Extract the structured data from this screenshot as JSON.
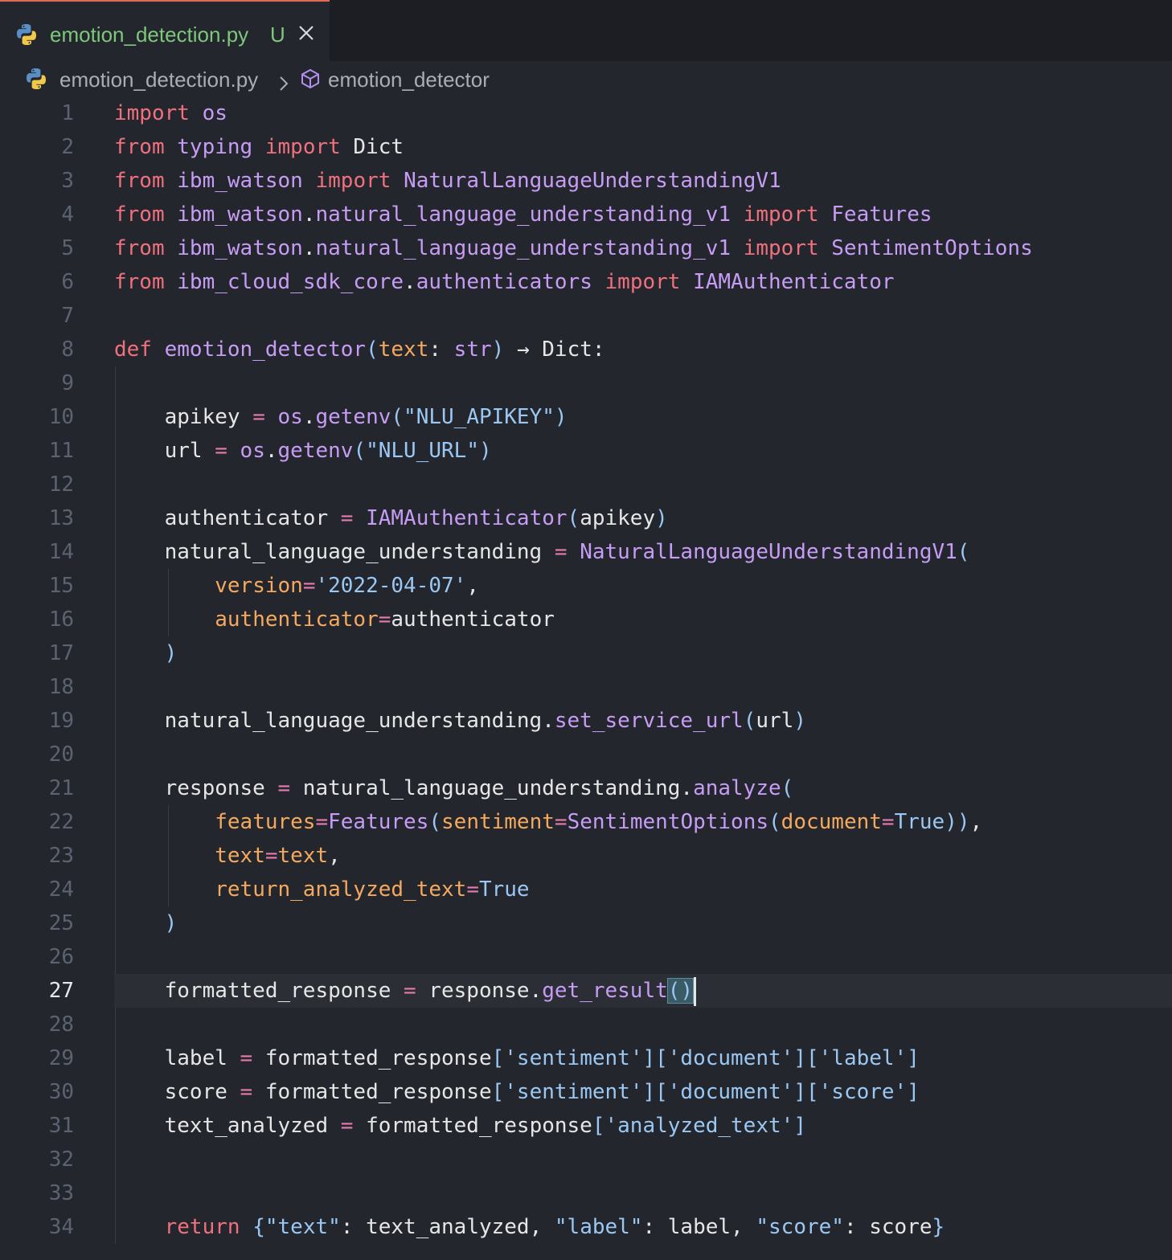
{
  "tab": {
    "filename": "emotion_detection.py",
    "status": "U",
    "icon": "python-icon",
    "close_icon": "close-icon"
  },
  "breadcrumb": {
    "file": "emotion_detection.py",
    "separator_icon": "chevron-right-icon",
    "symbol_icon": "cube-icon",
    "symbol": "emotion_detector"
  },
  "editor": {
    "current_line": 27,
    "lines": [
      {
        "n": "1",
        "tokens": [
          [
            "kw",
            "import"
          ],
          [
            "pl",
            " "
          ],
          [
            "mod",
            "os"
          ]
        ]
      },
      {
        "n": "2",
        "tokens": [
          [
            "kw",
            "from"
          ],
          [
            "pl",
            " "
          ],
          [
            "mod",
            "typing"
          ],
          [
            "pl",
            " "
          ],
          [
            "kw",
            "import"
          ],
          [
            "pl",
            " Dict"
          ]
        ]
      },
      {
        "n": "3",
        "tokens": [
          [
            "kw",
            "from"
          ],
          [
            "pl",
            " "
          ],
          [
            "mod",
            "ibm_watson"
          ],
          [
            "pl",
            " "
          ],
          [
            "kw",
            "import"
          ],
          [
            "pl",
            " "
          ],
          [
            "cls",
            "NaturalLanguageUnderstandingV1"
          ]
        ]
      },
      {
        "n": "4",
        "tokens": [
          [
            "kw",
            "from"
          ],
          [
            "pl",
            " "
          ],
          [
            "mod",
            "ibm_watson"
          ],
          [
            "pl",
            "."
          ],
          [
            "mod",
            "natural_language_understanding_v1"
          ],
          [
            "pl",
            " "
          ],
          [
            "kw",
            "import"
          ],
          [
            "pl",
            " "
          ],
          [
            "cls",
            "Features"
          ]
        ]
      },
      {
        "n": "5",
        "tokens": [
          [
            "kw",
            "from"
          ],
          [
            "pl",
            " "
          ],
          [
            "mod",
            "ibm_watson"
          ],
          [
            "pl",
            "."
          ],
          [
            "mod",
            "natural_language_understanding_v1"
          ],
          [
            "pl",
            " "
          ],
          [
            "kw",
            "import"
          ],
          [
            "pl",
            " "
          ],
          [
            "cls",
            "SentimentOptions"
          ]
        ]
      },
      {
        "n": "6",
        "tokens": [
          [
            "kw",
            "from"
          ],
          [
            "pl",
            " "
          ],
          [
            "mod",
            "ibm_cloud_sdk_core"
          ],
          [
            "pl",
            "."
          ],
          [
            "mod",
            "authenticators"
          ],
          [
            "pl",
            " "
          ],
          [
            "kw",
            "import"
          ],
          [
            "pl",
            " "
          ],
          [
            "cls",
            "IAMAuthenticator"
          ]
        ]
      },
      {
        "n": "7",
        "tokens": []
      },
      {
        "n": "8",
        "tokens": [
          [
            "kw",
            "def"
          ],
          [
            "pl",
            " "
          ],
          [
            "fn",
            "emotion_detector"
          ],
          [
            "br",
            "("
          ],
          [
            "par",
            "text"
          ],
          [
            "pl",
            ": "
          ],
          [
            "cls",
            "str"
          ],
          [
            "br",
            ")"
          ],
          [
            "pl",
            " → Dict:"
          ]
        ]
      },
      {
        "n": "9",
        "tokens": []
      },
      {
        "n": "10",
        "tokens": [
          [
            "pl",
            "    apikey "
          ],
          [
            "op",
            "="
          ],
          [
            "pl",
            " "
          ],
          [
            "mod",
            "os"
          ],
          [
            "pl",
            "."
          ],
          [
            "fn",
            "getenv"
          ],
          [
            "br",
            "("
          ],
          [
            "str",
            "\"NLU_APIKEY\""
          ],
          [
            "br",
            ")"
          ]
        ]
      },
      {
        "n": "11",
        "tokens": [
          [
            "pl",
            "    url "
          ],
          [
            "op",
            "="
          ],
          [
            "pl",
            " "
          ],
          [
            "mod",
            "os"
          ],
          [
            "pl",
            "."
          ],
          [
            "fn",
            "getenv"
          ],
          [
            "br",
            "("
          ],
          [
            "str",
            "\"NLU_URL\""
          ],
          [
            "br",
            ")"
          ]
        ]
      },
      {
        "n": "12",
        "tokens": []
      },
      {
        "n": "13",
        "tokens": [
          [
            "pl",
            "    authenticator "
          ],
          [
            "op",
            "="
          ],
          [
            "pl",
            " "
          ],
          [
            "cls",
            "IAMAuthenticator"
          ],
          [
            "br",
            "("
          ],
          [
            "pl",
            "apikey"
          ],
          [
            "br",
            ")"
          ]
        ]
      },
      {
        "n": "14",
        "tokens": [
          [
            "pl",
            "    natural_language_understanding "
          ],
          [
            "op",
            "="
          ],
          [
            "pl",
            " "
          ],
          [
            "cls",
            "NaturalLanguageUnderstandingV1"
          ],
          [
            "br",
            "("
          ]
        ]
      },
      {
        "n": "15",
        "tokens": [
          [
            "pl",
            "        "
          ],
          [
            "par",
            "version"
          ],
          [
            "op",
            "="
          ],
          [
            "str",
            "'2022-04-07'"
          ],
          [
            "pl",
            ","
          ]
        ]
      },
      {
        "n": "16",
        "tokens": [
          [
            "pl",
            "        "
          ],
          [
            "par",
            "authenticator"
          ],
          [
            "op",
            "="
          ],
          [
            "pl",
            "authenticator"
          ]
        ]
      },
      {
        "n": "17",
        "tokens": [
          [
            "pl",
            "    "
          ],
          [
            "br",
            ")"
          ]
        ]
      },
      {
        "n": "18",
        "tokens": []
      },
      {
        "n": "19",
        "tokens": [
          [
            "pl",
            "    natural_language_understanding."
          ],
          [
            "fn",
            "set_service_url"
          ],
          [
            "br",
            "("
          ],
          [
            "pl",
            "url"
          ],
          [
            "br",
            ")"
          ]
        ]
      },
      {
        "n": "20",
        "tokens": []
      },
      {
        "n": "21",
        "tokens": [
          [
            "pl",
            "    response "
          ],
          [
            "op",
            "="
          ],
          [
            "pl",
            " natural_language_understanding."
          ],
          [
            "fn",
            "analyze"
          ],
          [
            "br",
            "("
          ]
        ]
      },
      {
        "n": "22",
        "tokens": [
          [
            "pl",
            "        "
          ],
          [
            "par",
            "features"
          ],
          [
            "op",
            "="
          ],
          [
            "cls",
            "Features"
          ],
          [
            "br",
            "("
          ],
          [
            "par",
            "sentiment"
          ],
          [
            "op",
            "="
          ],
          [
            "cls",
            "SentimentOptions"
          ],
          [
            "br",
            "("
          ],
          [
            "par",
            "document"
          ],
          [
            "op",
            "="
          ],
          [
            "bool",
            "True"
          ],
          [
            "br",
            "))"
          ],
          [
            "pl",
            ","
          ]
        ]
      },
      {
        "n": "23",
        "tokens": [
          [
            "pl",
            "        "
          ],
          [
            "par",
            "text"
          ],
          [
            "op",
            "="
          ],
          [
            "par",
            "text"
          ],
          [
            "pl",
            ","
          ]
        ]
      },
      {
        "n": "24",
        "tokens": [
          [
            "pl",
            "        "
          ],
          [
            "par",
            "return_analyzed_text"
          ],
          [
            "op",
            "="
          ],
          [
            "bool",
            "True"
          ]
        ]
      },
      {
        "n": "25",
        "tokens": [
          [
            "pl",
            "    "
          ],
          [
            "br",
            ")"
          ]
        ]
      },
      {
        "n": "26",
        "tokens": []
      },
      {
        "n": "27",
        "tokens": [
          [
            "pl",
            "    formatted_response "
          ],
          [
            "op",
            "="
          ],
          [
            "pl",
            " response."
          ],
          [
            "fn",
            "get_result"
          ],
          [
            "br mbr",
            "()"
          ],
          [
            "caret",
            ""
          ]
        ]
      },
      {
        "n": "28",
        "tokens": []
      },
      {
        "n": "29",
        "tokens": [
          [
            "pl",
            "    label "
          ],
          [
            "op",
            "="
          ],
          [
            "pl",
            " formatted_response"
          ],
          [
            "br",
            "["
          ],
          [
            "str",
            "'sentiment'"
          ],
          [
            "br",
            "]["
          ],
          [
            "str",
            "'document'"
          ],
          [
            "br",
            "]["
          ],
          [
            "str",
            "'label'"
          ],
          [
            "br",
            "]"
          ]
        ]
      },
      {
        "n": "30",
        "tokens": [
          [
            "pl",
            "    score "
          ],
          [
            "op",
            "="
          ],
          [
            "pl",
            " formatted_response"
          ],
          [
            "br",
            "["
          ],
          [
            "str",
            "'sentiment'"
          ],
          [
            "br",
            "]["
          ],
          [
            "str",
            "'document'"
          ],
          [
            "br",
            "]["
          ],
          [
            "str",
            "'score'"
          ],
          [
            "br",
            "]"
          ]
        ]
      },
      {
        "n": "31",
        "tokens": [
          [
            "pl",
            "    text_analyzed "
          ],
          [
            "op",
            "="
          ],
          [
            "pl",
            " formatted_response"
          ],
          [
            "br",
            "["
          ],
          [
            "str",
            "'analyzed_text'"
          ],
          [
            "br",
            "]"
          ]
        ]
      },
      {
        "n": "32",
        "tokens": []
      },
      {
        "n": "33",
        "tokens": []
      },
      {
        "n": "34",
        "tokens": [
          [
            "pl",
            "    "
          ],
          [
            "kw",
            "return"
          ],
          [
            "pl",
            " "
          ],
          [
            "br",
            "{"
          ],
          [
            "str",
            "\"text\""
          ],
          [
            "pl",
            ": text_analyzed, "
          ],
          [
            "str",
            "\"label\""
          ],
          [
            "pl",
            ": label, "
          ],
          [
            "str",
            "\"score\""
          ],
          [
            "pl",
            ": score"
          ],
          [
            "br",
            "}"
          ]
        ]
      }
    ]
  }
}
